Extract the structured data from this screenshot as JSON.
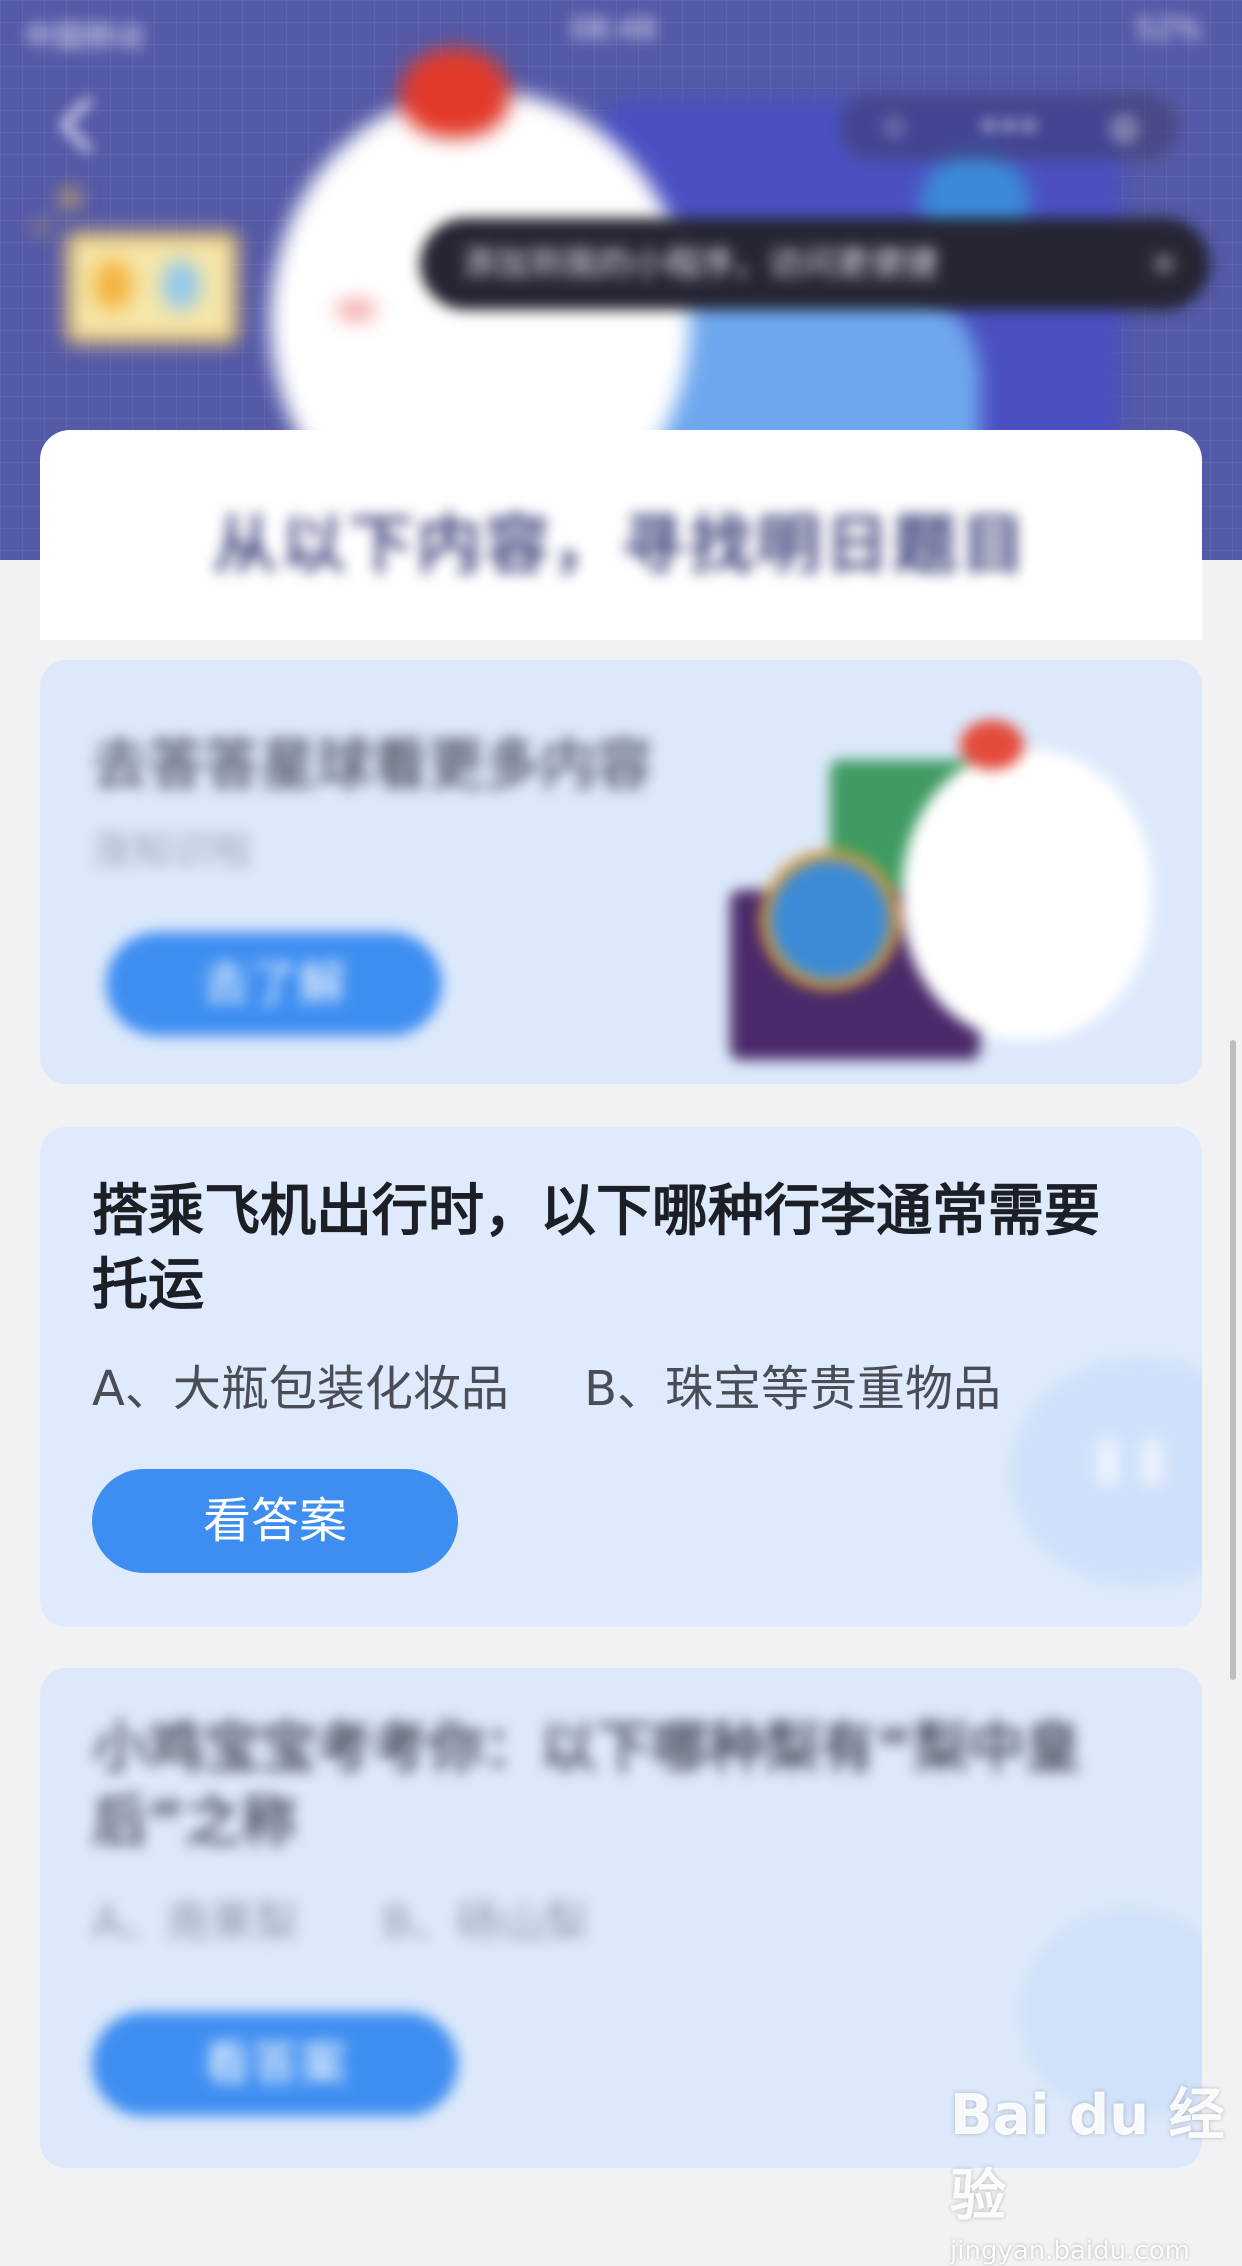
{
  "status_bar": {
    "carrier": "中国移动",
    "time": "08:48",
    "battery": "52%"
  },
  "header": {
    "back_icon": "chevron-left-icon",
    "capsule": {
      "star": "☆",
      "more": "•••",
      "target": "◎"
    },
    "tooltip": {
      "text": "添加到我的小程序，访问更便捷",
      "close": "×"
    },
    "heading": "从以下内容，寻找明日题目"
  },
  "card1": {
    "title": "去答答星球看更多内容",
    "subtitle": "涨知识啦",
    "button": "去了解"
  },
  "card2": {
    "question": "搭乘飞机出行时，以下哪种行李通常需要托运",
    "option_a": "A、大瓶包装化妆品",
    "option_b": "B、珠宝等贵重物品",
    "button": "看答案"
  },
  "card3": {
    "question": "小鸡宝宝考考你：以下哪种梨有“梨中皇后”之称",
    "option_a": "A、南果梨",
    "option_b": "B、砀山梨",
    "button": "看答案"
  },
  "watermark": {
    "logo": "Bai du 经验",
    "url": "jingyan.baidu.com"
  },
  "colors": {
    "header_bg": "#5459a8",
    "card_bg": "#dde9fb",
    "button": "#3e8ef1"
  }
}
